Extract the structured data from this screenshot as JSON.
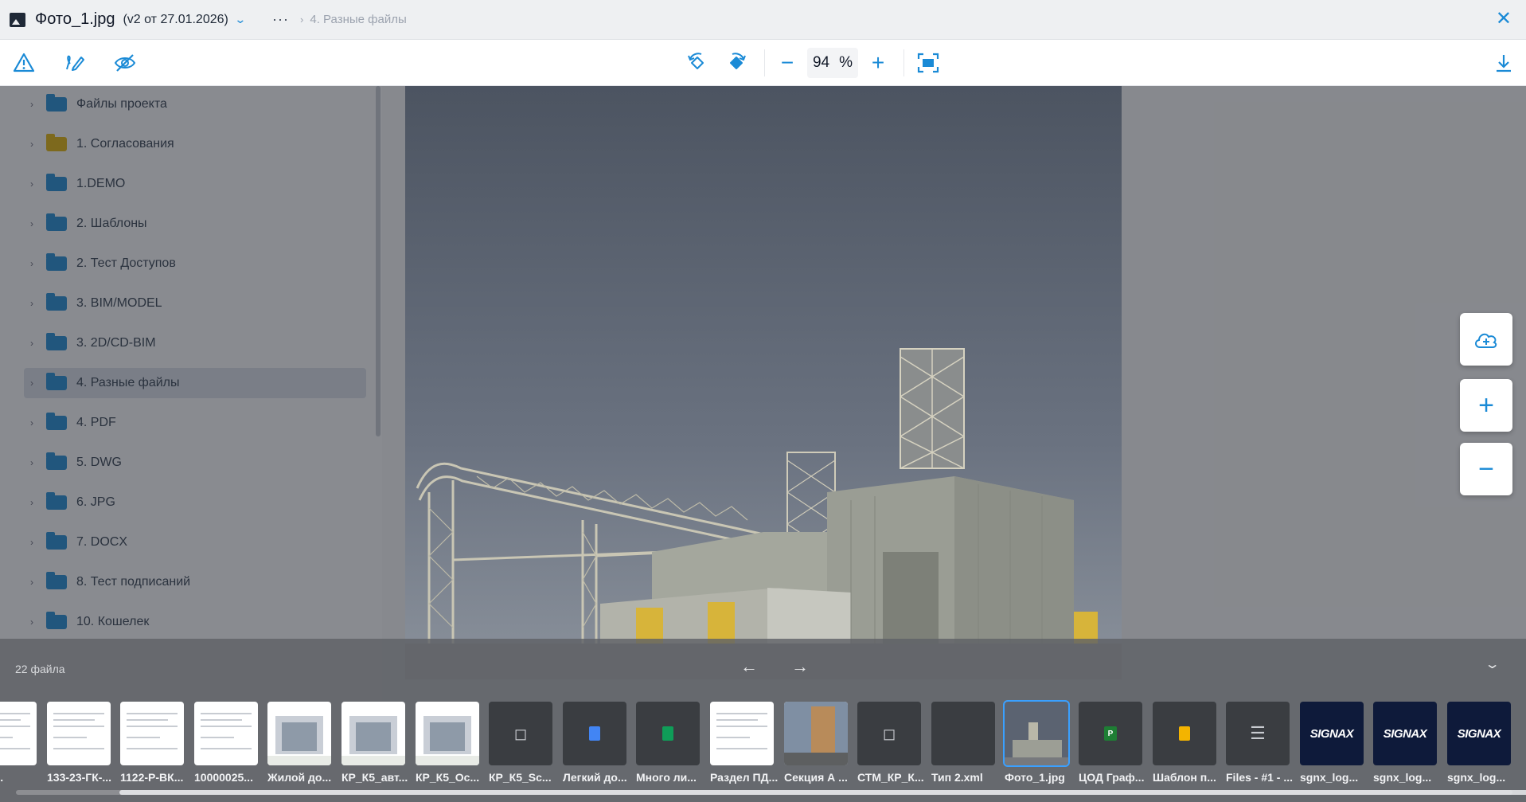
{
  "header": {
    "file_name": "Фото_1.jpg",
    "version": "(v2 от 27.01.2026)",
    "more": "···",
    "breadcrumb": "4. Разные файлы"
  },
  "toolbar": {
    "zoom_value": "94",
    "zoom_unit": "%"
  },
  "tree": {
    "items": [
      {
        "label": "Файлы проекта",
        "folder": "blue"
      },
      {
        "label": "1. Согласования",
        "folder": "yellow"
      },
      {
        "label": "1.DEMO",
        "folder": "blue"
      },
      {
        "label": "2. Шаблоны",
        "folder": "blue"
      },
      {
        "label": "2. Тест Доступов",
        "folder": "blue"
      },
      {
        "label": "3. BIM/MODEL",
        "folder": "blue"
      },
      {
        "label": "3. 2D/CD-BIM",
        "folder": "blue"
      },
      {
        "label": "4. Разные файлы",
        "folder": "blue"
      },
      {
        "label": "4. PDF",
        "folder": "blue"
      },
      {
        "label": "5. DWG",
        "folder": "blue"
      },
      {
        "label": "6. JPG",
        "folder": "blue"
      },
      {
        "label": "7. DOCX",
        "folder": "blue"
      },
      {
        "label": "8. Тест подписаний",
        "folder": "blue"
      },
      {
        "label": "10. Кошелек",
        "folder": "blue"
      }
    ]
  },
  "filmstrip": {
    "count_label": "22 файла",
    "thumbs": [
      {
        "label": "ES_...",
        "kind": "doc"
      },
      {
        "label": "133-23-ГК-...",
        "kind": "doc"
      },
      {
        "label": "1122-Р-ВК...",
        "kind": "doc"
      },
      {
        "label": "10000025...",
        "kind": "doc"
      },
      {
        "label": "Жилой до...",
        "kind": "render"
      },
      {
        "label": "КР_К5_авт...",
        "kind": "render"
      },
      {
        "label": "КР_К5_Ос...",
        "kind": "render"
      },
      {
        "label": "КР_К5_Sc...",
        "kind": "model"
      },
      {
        "label": "Легкий до...",
        "kind": "gdoc"
      },
      {
        "label": "Много ли...",
        "kind": "gsheet"
      },
      {
        "label": "Раздел ПД...",
        "kind": "doc"
      },
      {
        "label": "Секция А ...",
        "kind": "photo"
      },
      {
        "label": "СТМ_КР_К...",
        "kind": "model"
      },
      {
        "label": "Тип 2.xml",
        "kind": "empty"
      },
      {
        "label": "Фото_1.jpg",
        "kind": "selected"
      },
      {
        "label": "ЦОД Граф...",
        "kind": "gproject"
      },
      {
        "label": "Шаблон п...",
        "kind": "gslides"
      },
      {
        "label": "Files - #1 - ...",
        "kind": "list"
      },
      {
        "label": "sgnx_log...",
        "kind": "logo"
      },
      {
        "label": "sgnx_log...",
        "kind": "logo"
      },
      {
        "label": "sgnx_log...",
        "kind": "logo"
      }
    ],
    "logo_text": "SIGNAX",
    "project_letter": "P"
  },
  "colors": {
    "accent": "#1a8ad6",
    "overlay": "#5f6266",
    "selected_outline": "#3aa0ff"
  }
}
